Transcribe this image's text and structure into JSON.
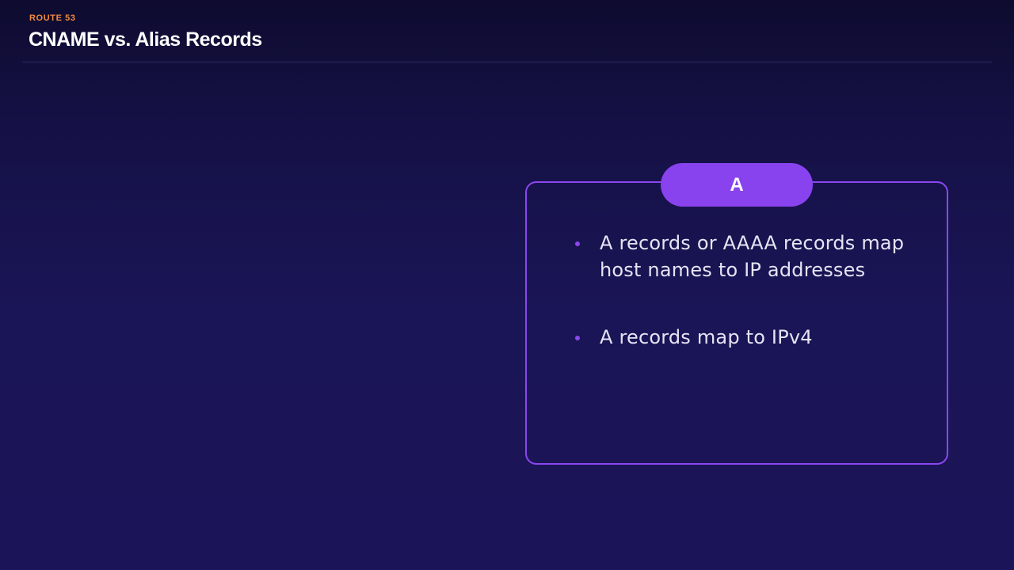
{
  "header": {
    "eyebrow": "ROUTE 53",
    "title": "CNAME vs. Alias Records"
  },
  "card": {
    "tab_label": "A",
    "bullets": [
      "A records or AAAA records map host names to IP addresses",
      "A records map to IPv4"
    ]
  },
  "colors": {
    "accent": "#8b47ee",
    "eyebrow": "#f08a3c",
    "background_top": "#0e0b2f",
    "background_bottom": "#1c1458"
  }
}
